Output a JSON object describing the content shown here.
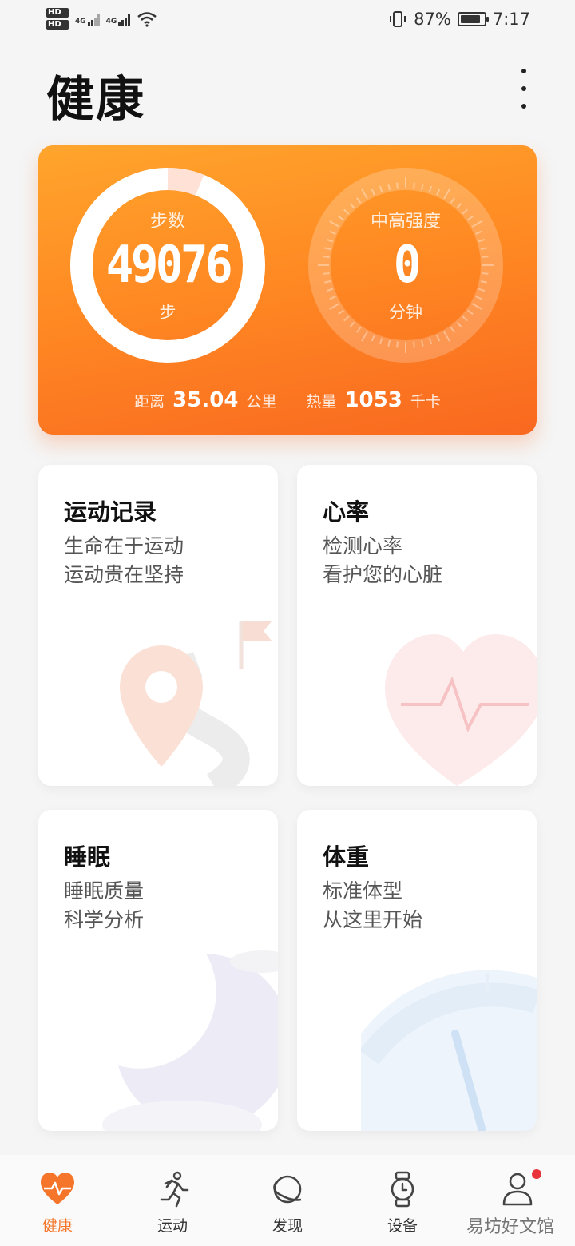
{
  "status_bar": {
    "hd1": "HD",
    "hd2": "HD",
    "net1": "4G",
    "net2": "4G",
    "battery_percent": "87%",
    "battery_level": 0.87,
    "time": "7:17"
  },
  "header": {
    "title": "健康"
  },
  "activity": {
    "steps_label": "步数",
    "steps_value": "49076",
    "steps_unit": "步",
    "intensity_label": "中高强度",
    "intensity_value": "0",
    "intensity_unit": "分钟",
    "distance_label": "距离",
    "distance_value": "35.04",
    "distance_unit": "公里",
    "calories_label": "热量",
    "calories_value": "1053",
    "calories_unit": "千卡",
    "colors": {
      "start": "#ffa52c",
      "end": "#f96820"
    }
  },
  "tiles": [
    {
      "title": "运动记录",
      "line1": "生命在于运动",
      "line2": "运动贵在坚持",
      "icon": "location-pin-icon"
    },
    {
      "title": "心率",
      "line1": "检测心率",
      "line2": "看护您的心脏",
      "icon": "heart-pulse-icon"
    },
    {
      "title": "睡眠",
      "line1": "睡眠质量",
      "line2": "科学分析",
      "icon": "moon-icon"
    },
    {
      "title": "体重",
      "line1": "标准体型",
      "line2": "从这里开始",
      "icon": "scale-gauge-icon"
    }
  ],
  "nav": [
    {
      "label": "健康",
      "icon": "heart-pulse-icon",
      "active": true
    },
    {
      "label": "运动",
      "icon": "runner-icon"
    },
    {
      "label": "发现",
      "icon": "planet-icon"
    },
    {
      "label": "设备",
      "icon": "watch-icon"
    },
    {
      "label": "",
      "icon": "person-icon"
    }
  ],
  "watermark": "易坊好文馆",
  "accent_color": "#f5762a"
}
